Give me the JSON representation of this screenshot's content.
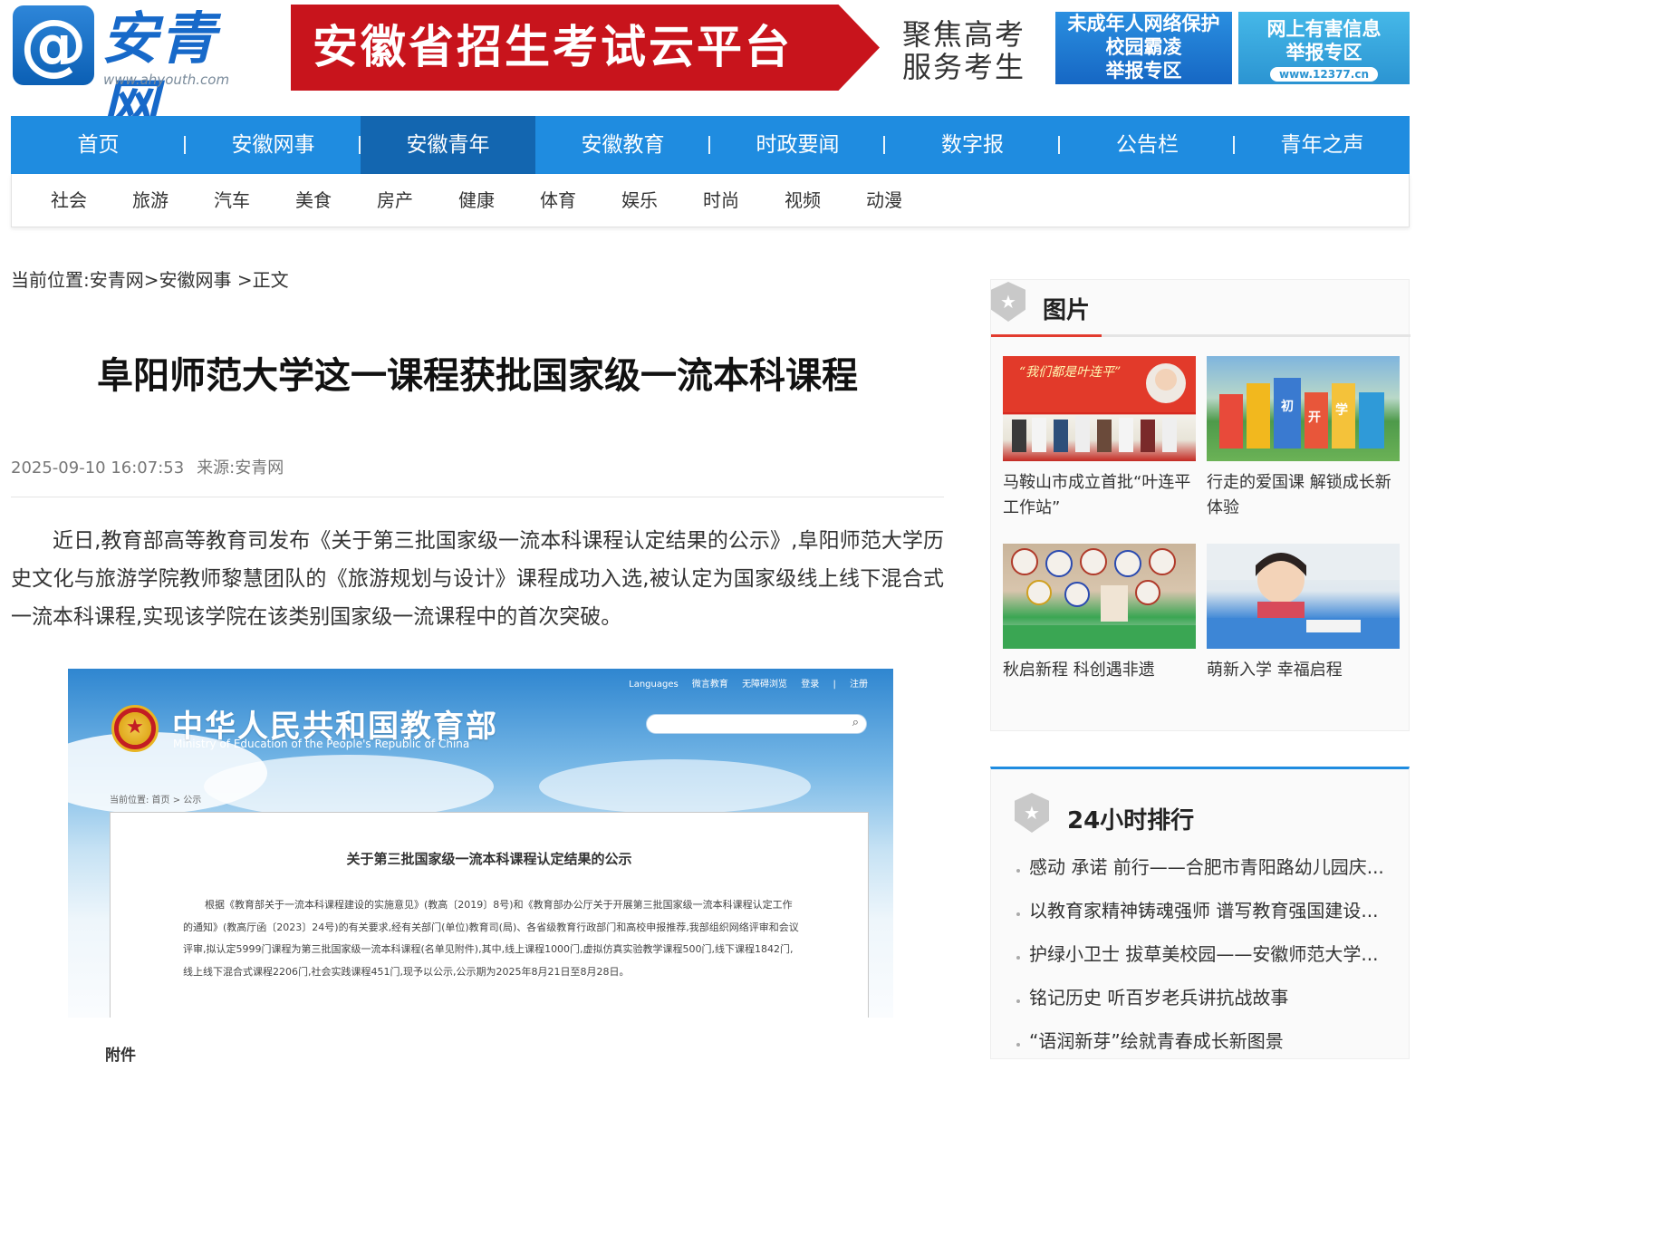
{
  "header": {
    "logo_mark": "@",
    "logo_text": "安青网",
    "logo_url": "www.ahyouth.com",
    "banner_main": "安徽省招生考试云平台",
    "banner_sub_line1": "聚焦高考",
    "banner_sub_line2": "服务考生",
    "badge1": {
      "line1": "未成年人网络保护",
      "line2": "校园霸凌",
      "line3": "举报专区"
    },
    "badge2": {
      "line1": "网上有害信息",
      "line2": "举报专区",
      "url": "www.12377.cn"
    }
  },
  "nav": {
    "items": [
      {
        "label": "首页"
      },
      {
        "label": "安徽网事"
      },
      {
        "label": "安徽青年"
      },
      {
        "label": "安徽教育"
      },
      {
        "label": "时政要闻"
      },
      {
        "label": "数字报"
      },
      {
        "label": "公告栏"
      },
      {
        "label": "青年之声"
      }
    ],
    "active_index": 2,
    "sub_items": [
      {
        "label": "社会"
      },
      {
        "label": "旅游"
      },
      {
        "label": "汽车"
      },
      {
        "label": "美食"
      },
      {
        "label": "房产"
      },
      {
        "label": "健康"
      },
      {
        "label": "体育"
      },
      {
        "label": "娱乐"
      },
      {
        "label": "时尚"
      },
      {
        "label": "视频"
      },
      {
        "label": "动漫"
      }
    ]
  },
  "article": {
    "breadcrumb_prefix": "当前位置:",
    "breadcrumb_home": "安青网",
    "breadcrumb_sep1": ">",
    "breadcrumb_section": "安徽网事",
    "breadcrumb_sep2": " >",
    "breadcrumb_current": "正文",
    "title": "阜阳师范大学这一课程获批国家级一流本科课程",
    "datetime": "2025-09-10 16:07:53",
    "source": "来源:安青网",
    "body": "近日,教育部高等教育司发布《关于第三批国家级一流本科课程认定结果的公示》,阜阳师范大学历史文化与旅游学院教师黎慧团队的《旅游规划与设计》课程成功入选,被认定为国家级线上线下混合式一流本科课程,实现该学院在该类别国家级一流课程中的首次突破。",
    "embed": {
      "top_links": [
        "Languages",
        "微言教育",
        "无障碍浏览",
        "登录",
        "|",
        "注册"
      ],
      "site_title": "中华人民共和国教育部",
      "site_subtitle": "Ministry of Education of the People's Republic of China",
      "crumb": "当前位置: 首页 > 公示",
      "notice_title": "关于第三批国家级一流本科课程认定结果的公示",
      "notice_text": "根据《教育部关于一流本科课程建设的实施意见》(教高〔2019〕8号)和《教育部办公厅关于开展第三批国家级一流本科课程认定工作的通知》(教高厅函〔2023〕24号)的有关要求,经有关部门(单位)教育司(局)、各省级教育行政部门和高校申报推荐,我部组织网络评审和会议评审,拟认定5999门课程为第三批国家级一流本科课程(名单见附件),其中,线上课程1000门,虚拟仿真实验教学课程500门,线下课程1842门,线上线下混合式课程2206门,社会实践课程451门,现予以公示,公示期为2025年8月21日至8月28日。"
    },
    "attachment_label": "附件"
  },
  "sidebar": {
    "pics_title": "图片",
    "pics": [
      {
        "caption": "马鞍山市成立首批“叶连平工作站”"
      },
      {
        "caption": "行走的爱国课 解锁成长新体验"
      },
      {
        "caption": "秋启新程 科创遇非遗"
      },
      {
        "caption": "萌新入学 幸福启程"
      }
    ],
    "rank_title": "24小时排行",
    "rank_items": [
      "感动 承诺 前行——合肥市青阳路幼儿园庆...",
      "以教育家精神铸魂强师 谱写教育强国建设...",
      "护绿小卫士 拔草美校园——安徽师范大学...",
      "铭记历史 听百岁老兵讲抗战故事",
      "“语润新芽”绘就青春成长新图景"
    ]
  },
  "colors": {
    "nav_blue": "#1f8ce0",
    "nav_active": "#1366b0",
    "banner_red": "#c8141c",
    "accent_red": "#e23b2e"
  }
}
